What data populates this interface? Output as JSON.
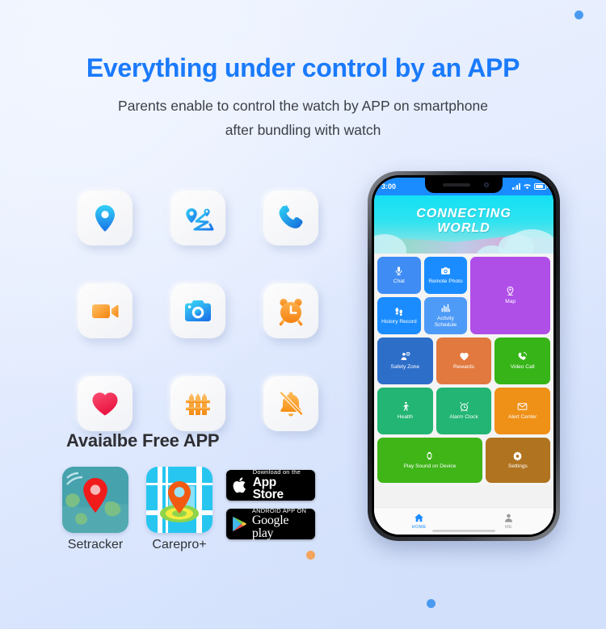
{
  "header": {
    "headline": "Everything under control by an APP",
    "sub_line1": "Parents enable to control the watch by APP on smartphone",
    "sub_line2": "after bundling with watch",
    "headline_color": "#1a7afc"
  },
  "feature_icons": [
    {
      "name": "location-pin-icon",
      "label": "Location"
    },
    {
      "name": "route-tracking-icon",
      "label": "Route Tracking"
    },
    {
      "name": "phone-call-icon",
      "label": "Phone Call"
    },
    {
      "name": "video-call-icon",
      "label": "Video Call"
    },
    {
      "name": "camera-icon",
      "label": "Remote Camera"
    },
    {
      "name": "alarm-clock-icon",
      "label": "Alarm Clock"
    },
    {
      "name": "heart-health-icon",
      "label": "Health"
    },
    {
      "name": "fence-geofence-icon",
      "label": "Safety Fence"
    },
    {
      "name": "bell-off-icon",
      "label": "Silent Mode"
    }
  ],
  "free_app": {
    "title": "Avaialbe Free APP",
    "apps": [
      {
        "name": "setracker",
        "caption": "Setracker"
      },
      {
        "name": "carepro",
        "caption": "Carepro+"
      }
    ],
    "badges": [
      {
        "name": "app-store-badge",
        "top": "Download on the",
        "bottom": "App Store"
      },
      {
        "name": "google-play-badge",
        "top": "ANDROID APP ON",
        "bottom": "Google play"
      }
    ]
  },
  "phone": {
    "status": {
      "time": "3:00",
      "signal": "signal-bars-icon",
      "wifi": "wifi-icon",
      "battery": "battery-icon"
    },
    "banner": {
      "line1": "CONNECTING",
      "line2": "WORLD"
    },
    "tiles": [
      {
        "label": "Chat",
        "icon": "microphone-icon",
        "color": "#3f8cf4"
      },
      {
        "label": "Remote Photo",
        "icon": "camera-icon",
        "color": "#1a8cff"
      },
      {
        "label": "Map",
        "icon": "map-pin-icon",
        "color": "#b04ee8"
      },
      {
        "label": "History Record",
        "icon": "footprints-icon",
        "color": "#1a8cff"
      },
      {
        "label": "Activity Schedule",
        "icon": "activity-bars-icon",
        "color": "#4e9af7"
      },
      {
        "label": "Safety Zone",
        "icon": "safety-zone-icon",
        "color": "#2d6ec9"
      },
      {
        "label": "Rewards",
        "icon": "heart-icon",
        "color": "#e2793f"
      },
      {
        "label": "Video Call",
        "icon": "video-phone-icon",
        "color": "#37b518"
      },
      {
        "label": "Health",
        "icon": "walking-icon",
        "color": "#22b573"
      },
      {
        "label": "Alarm Clock",
        "icon": "alarm-icon",
        "color": "#22b573"
      },
      {
        "label": "Alert Center",
        "icon": "envelope-icon",
        "color": "#ef9017"
      },
      {
        "label": "Play Sound on Device",
        "icon": "watch-icon",
        "color": "#3fb518"
      },
      {
        "label": "Settings",
        "icon": "gear-icon",
        "color": "#b0731f"
      }
    ],
    "tabs": [
      {
        "label": "HOME",
        "icon": "home-icon",
        "active": true
      },
      {
        "label": "ME",
        "icon": "person-icon",
        "active": false
      }
    ]
  },
  "decor_dots": [
    {
      "name": "dot-top-right",
      "color": "#4a9bf0"
    },
    {
      "name": "dot-bottom-left",
      "color": "#f5a45c"
    },
    {
      "name": "dot-bottom-center",
      "color": "#4a9bf0"
    }
  ]
}
